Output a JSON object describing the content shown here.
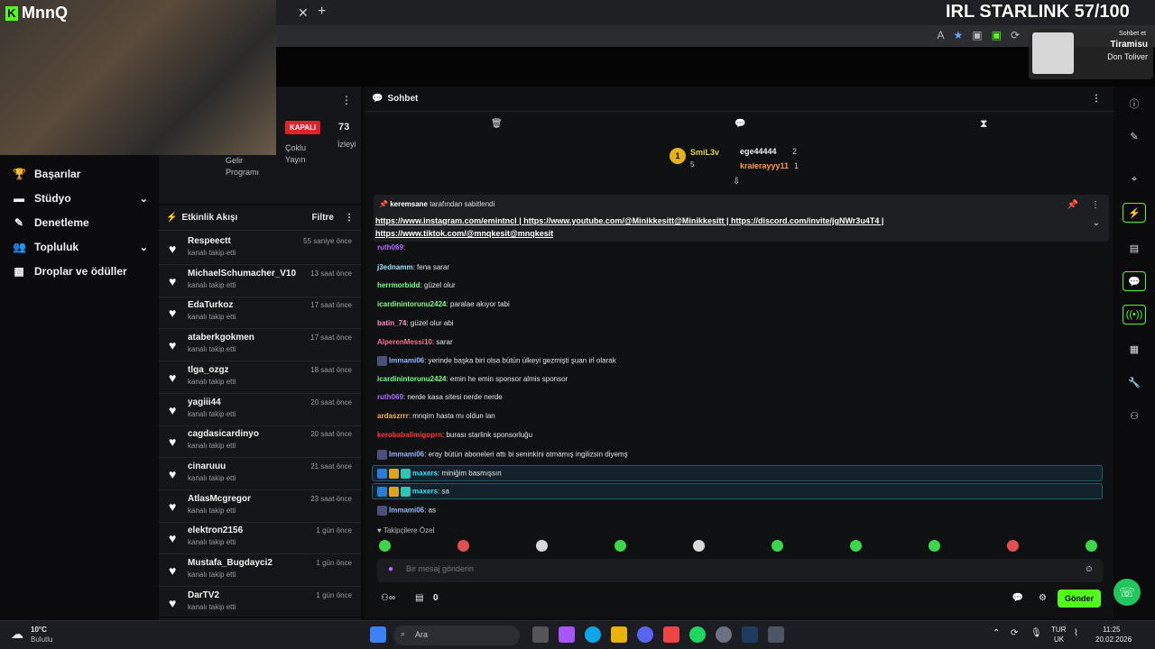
{
  "overlay": {
    "logo": "MnnQ",
    "goal_text": "IRL STARLINK 57/100",
    "now_playing": {
      "label": "Sohbet et",
      "title": "Tiramisu",
      "artist": "Don Toliver"
    }
  },
  "sidebar": {
    "items": [
      {
        "label": "Başarılar",
        "icon": "trophy-icon"
      },
      {
        "label": "Stüdyo",
        "icon": "studio-icon",
        "chevron": "⌄"
      },
      {
        "label": "Denetleme",
        "icon": "wrench-icon"
      },
      {
        "label": "Topluluk",
        "icon": "community-icon",
        "chevron": "⌄"
      },
      {
        "label": "Droplar ve ödüller",
        "icon": "gift-icon"
      }
    ]
  },
  "stats": {
    "status_badge": "KAPALI",
    "viewer_count": "73",
    "income_label": "Gelir Programı",
    "multistream_label": "Çoklu Yayın",
    "viewers_label": "İzleyi"
  },
  "feed": {
    "title": "Etkinlik Akışı",
    "filter_label": "Filtre",
    "items": [
      {
        "name": "Respeectt",
        "action": "kanalı takip etti",
        "time": "55 saniye önce"
      },
      {
        "name": "MichaelSchumacher_V10",
        "action": "kanalı takip etti",
        "time": "13 saat önce"
      },
      {
        "name": "EdaTurkoz",
        "action": "kanalı takip etti",
        "time": "17 saat önce"
      },
      {
        "name": "ataberkgokmen",
        "action": "kanalı takip etti",
        "time": "17 saat önce"
      },
      {
        "name": "tlga_ozgz",
        "action": "kanalı takip etti",
        "time": "18 saat önce"
      },
      {
        "name": "yagiii44",
        "action": "kanalı takip etti",
        "time": "20 saat önce"
      },
      {
        "name": "cagdasicardinyo",
        "action": "kanalı takip etti",
        "time": "20 saat önce"
      },
      {
        "name": "cinaruuu",
        "action": "kanalı takip etti",
        "time": "21 saat önce"
      },
      {
        "name": "AtlasMcgregor",
        "action": "kanalı takip etti",
        "time": "23 saat önce"
      },
      {
        "name": "elektron2156",
        "action": "kanalı takip etti",
        "time": "1 gün önce"
      },
      {
        "name": "Mustafa_Bugdayci2",
        "action": "kanalı takip etti",
        "time": "1 gün önce"
      },
      {
        "name": "DarTV2",
        "action": "kanalı takip etti",
        "time": "1 gün önce"
      }
    ]
  },
  "chat": {
    "title": "Sohbet",
    "leaderboard": [
      {
        "rank": "1",
        "name": "SmiL3v",
        "score": "5"
      },
      {
        "name": "ege44444",
        "score": "2"
      },
      {
        "name": "kraierayyy11",
        "score": "1"
      }
    ],
    "pinned": {
      "pinned_by": "keremsane",
      "pinned_suffix": "tarafından sabitlendi",
      "links": "https://www.instagram.com/emintncl | https://www.youtube.com/@Minikkesitt@Minikkesitt | https://discord.com/invite/jgNWr3u4T4 | https://www.tiktok.com/@mnqkesit@mnqkesit"
    },
    "messages": [
      {
        "user": "ruth069",
        "text": "",
        "color": "#b06bff"
      },
      {
        "user": "j3ednamm",
        "text": "fena sarar",
        "color": "#9be4ff"
      },
      {
        "user": "herrmorbidd",
        "text": "güzel olur",
        "color": "#7cff8a"
      },
      {
        "user": "icardinintorunu2424",
        "text": "paralae akıyor tabi",
        "color": "#7cff8a"
      },
      {
        "user": "batin_74",
        "text": "güzel olur abi",
        "color": "#ff8fd0"
      },
      {
        "user": "AlperenMessi10",
        "text": "sarar",
        "color": "#ff6f8a"
      },
      {
        "user": "Immami06",
        "text": "yerinde başka biri olsa bütün ülkeyi gezmişti şuan irl olarak",
        "color": "#9ab8ff"
      },
      {
        "user": "icardinintorunu2424",
        "text": "emin he emin sponsor almis sponsor",
        "color": "#7cff8a"
      },
      {
        "user": "ruth069",
        "text": "nerde kasa sitesi nerde nerde",
        "color": "#b06bff"
      },
      {
        "user": "ardaszrrr",
        "text": "mnqim hasta mı oldun lan",
        "color": "#ffb347"
      },
      {
        "user": "kerobabalimigoprn",
        "text": "burası starlink sponsorluğu",
        "color": "#ff3b3b"
      },
      {
        "user": "Immami06",
        "text": "eray bütün aboneleri attı bi seninkini atmamış ingilizsin diyemş",
        "color": "#9ab8ff"
      },
      {
        "user": "maxers",
        "text": "miniğim basmışsın",
        "color": "#3ee0ff"
      },
      {
        "user": "maxers",
        "text": "sa",
        "color": "#3ee0ff"
      },
      {
        "user": "Immami06",
        "text": "as",
        "color": "#9ab8ff"
      }
    ],
    "followers_only": "Takipçilere Özel",
    "input_placeholder": "Bir mesaj gönderin",
    "points": "0",
    "send_label": "Gönder"
  },
  "taskbar": {
    "weather_temp": "10°C",
    "weather_desc": "Bulutlu",
    "search_label": "Ara",
    "lang": "TUR",
    "lang_sub": "UK",
    "time": "11:25",
    "date": "20.02.2026"
  }
}
